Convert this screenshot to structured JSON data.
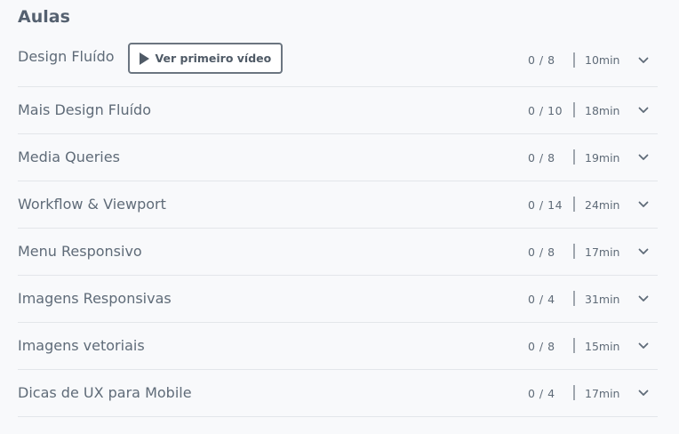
{
  "section": {
    "title": "Aulas",
    "first_video_label": "Ver primeiro vídeo",
    "separator": "|"
  },
  "lessons": [
    {
      "title": "Design Fluído",
      "progress": "0 / 8",
      "duration": "10min"
    },
    {
      "title": "Mais Design Fluído",
      "progress": "0 / 10",
      "duration": "18min"
    },
    {
      "title": "Media Queries",
      "progress": "0 / 8",
      "duration": "19min"
    },
    {
      "title": "Workflow & Viewport",
      "progress": "0 / 14",
      "duration": "24min"
    },
    {
      "title": "Menu Responsivo",
      "progress": "0 / 8",
      "duration": "17min"
    },
    {
      "title": "Imagens Responsivas",
      "progress": "0 / 4",
      "duration": "31min"
    },
    {
      "title": "Imagens vetoriais",
      "progress": "0 / 8",
      "duration": "15min"
    },
    {
      "title": "Dicas de UX para Mobile",
      "progress": "0 / 4",
      "duration": "17min"
    }
  ],
  "colors": {
    "background": "#f8f9fb",
    "text": "#5f6b78",
    "divider": "#e3e6ea",
    "button_border": "#6b7580"
  },
  "icons": {
    "play": "play-icon",
    "expand": "chevron-down-icon"
  }
}
